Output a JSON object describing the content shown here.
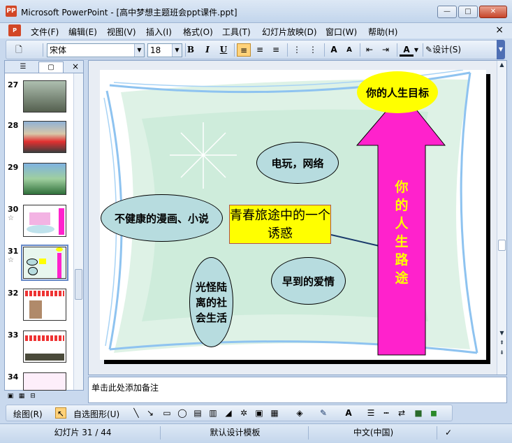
{
  "window": {
    "title": "Microsoft PowerPoint - [高中梦想主题班会ppt课件.ppt]",
    "app_icon": "PP",
    "btn_min": "—",
    "btn_max": "□",
    "btn_close": "✕"
  },
  "menu": {
    "items": [
      "文件(F)",
      "编辑(E)",
      "视图(V)",
      "插入(I)",
      "格式(O)",
      "工具(T)",
      "幻灯片放映(D)",
      "窗口(W)",
      "帮助(H)"
    ],
    "close": "×"
  },
  "toolbar": {
    "font": "宋体",
    "size": "18",
    "bold": "B",
    "italic": "I",
    "underline": "U",
    "design": "设计(S)"
  },
  "slides_panel": {
    "close": "×",
    "thumbs": [
      {
        "num": "27",
        "star": ""
      },
      {
        "num": "28",
        "star": ""
      },
      {
        "num": "29",
        "star": ""
      },
      {
        "num": "30",
        "star": "☆"
      },
      {
        "num": "31",
        "star": "☆"
      },
      {
        "num": "32",
        "star": ""
      },
      {
        "num": "33",
        "star": ""
      },
      {
        "num": "34",
        "star": ""
      }
    ]
  },
  "slide": {
    "center": "青春旅途中的一个诱惑",
    "goal": "你的人生目标",
    "path": "你的人生路途",
    "bubble_games": "电玩，网络",
    "bubble_comics": "不健康的漫画、小说",
    "bubble_love": "早到的爱情",
    "bubble_strange": "光怪陆离的社会生活"
  },
  "notes": {
    "placeholder": "单击此处添加备注"
  },
  "drawbar": {
    "draw": "绘图(R)",
    "autoshapes": "自选图形(U)"
  },
  "status": {
    "slide": "幻灯片 31 / 44",
    "template": "默认设计模板",
    "language": "中文(中国)"
  },
  "colors": {
    "goal_bg": "#ffff00",
    "arrow": "#ff22cc",
    "bubble": "#b7dcdf",
    "frame": "#8ec3f0"
  }
}
